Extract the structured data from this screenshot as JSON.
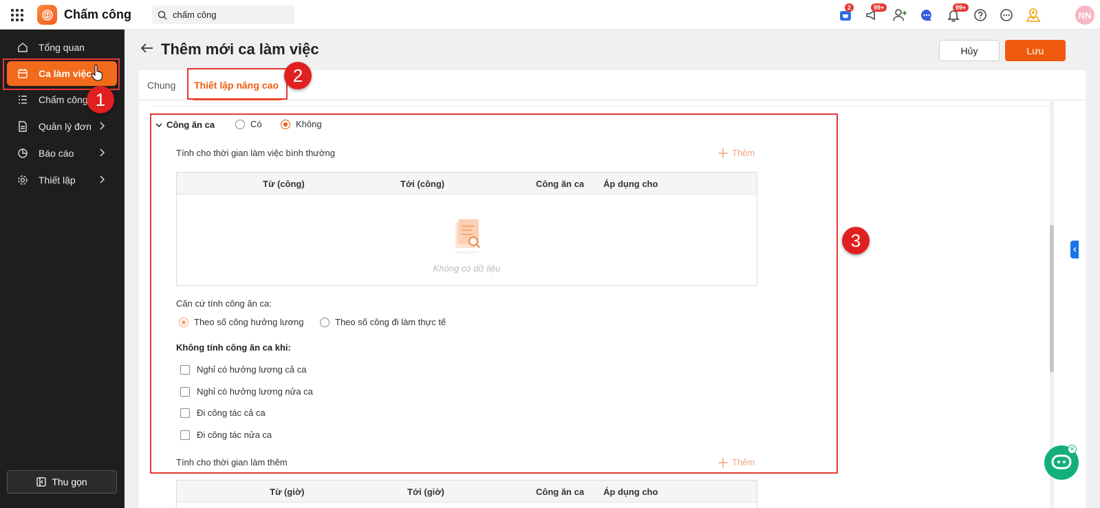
{
  "app": {
    "name": "Chấm công"
  },
  "search": {
    "value": "chấm công"
  },
  "header": {
    "cart_badge": "2",
    "announce_badge": "99+",
    "notif_badge": "99+",
    "avatar_initials": "NN"
  },
  "sidebar": {
    "items": [
      {
        "label": "Tổng quan"
      },
      {
        "label": "Ca làm việc"
      },
      {
        "label": "Chấm công"
      },
      {
        "label": "Quản lý đơn"
      },
      {
        "label": "Báo cáo"
      },
      {
        "label": "Thiết lập"
      }
    ],
    "collapse_label": "Thu gọn"
  },
  "page": {
    "title": "Thêm mới ca làm việc",
    "cancel_label": "Hủy",
    "save_label": "Lưu"
  },
  "tabs": [
    {
      "label": "Chung"
    },
    {
      "label": "Thiết lập nâng cao"
    }
  ],
  "annotations": {
    "one": "1",
    "two": "2",
    "three": "3"
  },
  "section": {
    "title": "Công ăn ca",
    "option_yes": "Có",
    "option_no": "Không",
    "selected": "Không",
    "normal_label": "Tính cho thời gian làm việc bình thường",
    "add_label": "Thêm",
    "table_headers": [
      "Từ (công)",
      "Tới (công)",
      "Công ăn ca",
      "Áp dụng cho"
    ],
    "empty_text": "Không có dữ liệu",
    "basis_label": "Căn cứ tính công ăn ca:",
    "basis_options": [
      "Theo số công hưởng lương",
      "Theo số công đi làm thực tế"
    ],
    "basis_selected": "Theo số công hưởng lương",
    "exclude_title": "Không tính công ăn ca khi:",
    "exclude_options": [
      "Nghỉ có hưởng lương cả ca",
      "Nghỉ có hưởng lương nửa ca",
      "Đi công tác cả ca",
      "Đi công tác nửa ca"
    ],
    "overtime_label": "Tính cho thời gian làm thêm",
    "overtime_headers": [
      "Từ (giờ)",
      "Tới (giờ)",
      "Công ăn ca",
      "Áp dụng cho"
    ]
  },
  "colors": {
    "accent": "#f05a0e",
    "sidebar_bg": "#1e1e1e",
    "annotation": "#e02020"
  }
}
